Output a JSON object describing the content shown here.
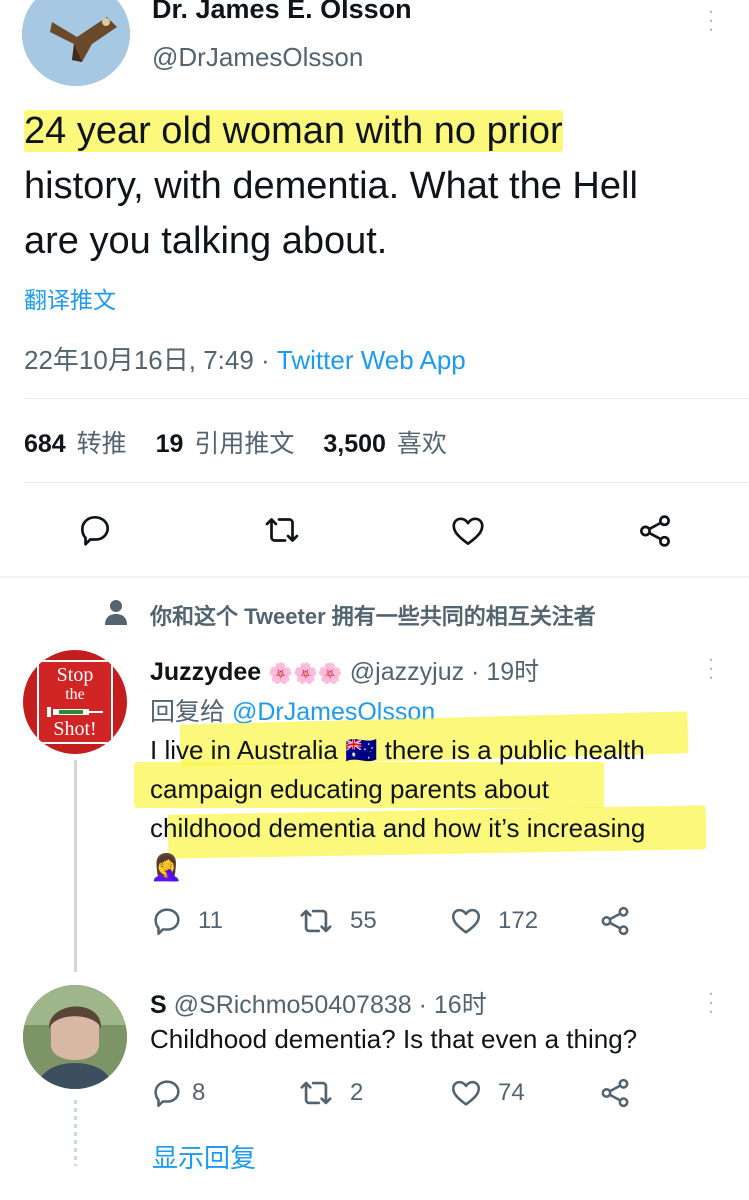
{
  "main_tweet": {
    "author_name": "Dr. James E. Olsson",
    "author_handle": "@DrJamesOlsson",
    "text_line1": "24 year old woman with no prior",
    "text_line2": "history, with dementia. What the Hell",
    "text_line3": "are you talking about.",
    "translate_label": "翻译推文",
    "timestamp": "22年10月16日, 7:49",
    "separator": " · ",
    "source": "Twitter Web App",
    "retweets_count": "684",
    "retweets_label": "转推",
    "quotes_count": "19",
    "quotes_label": "引用推文",
    "likes_count": "3,500",
    "likes_label": "喜欢"
  },
  "context_note": "你和这个 Tweeter 拥有一些共同的相互关注者",
  "replies": [
    {
      "author_name": "Juzzydee",
      "name_emoji": "🌸🌸🌸",
      "author_handle": "@jazzyjuz",
      "time": "· 19时",
      "reply_to_label": "回复给",
      "reply_to_handle": "@DrJamesOlsson",
      "text_line1": "I live in Australia 🇦🇺 there is a public health",
      "text_line2": "campaign educating parents about",
      "text_line3": "childhood dementia and how it’s increasing",
      "text_line4": "🤦‍♀️",
      "avatar_text1": "Stop",
      "avatar_text2": "the",
      "avatar_text3": "Shot!",
      "replies": "11",
      "retweets": "55",
      "likes": "172"
    },
    {
      "author_name": "S",
      "author_handle": "@SRichmo50407838",
      "time": "· 16时",
      "text_line1": "Childhood dementia? Is that even a thing?",
      "replies": "8",
      "retweets": "2",
      "likes": "74"
    }
  ],
  "show_replies_label": "显示回复",
  "colors": {
    "accent": "#1d9bf0",
    "highlight": "#f8f250",
    "text": "#0f1419",
    "muted": "#536471",
    "divider": "#eff3f4"
  }
}
